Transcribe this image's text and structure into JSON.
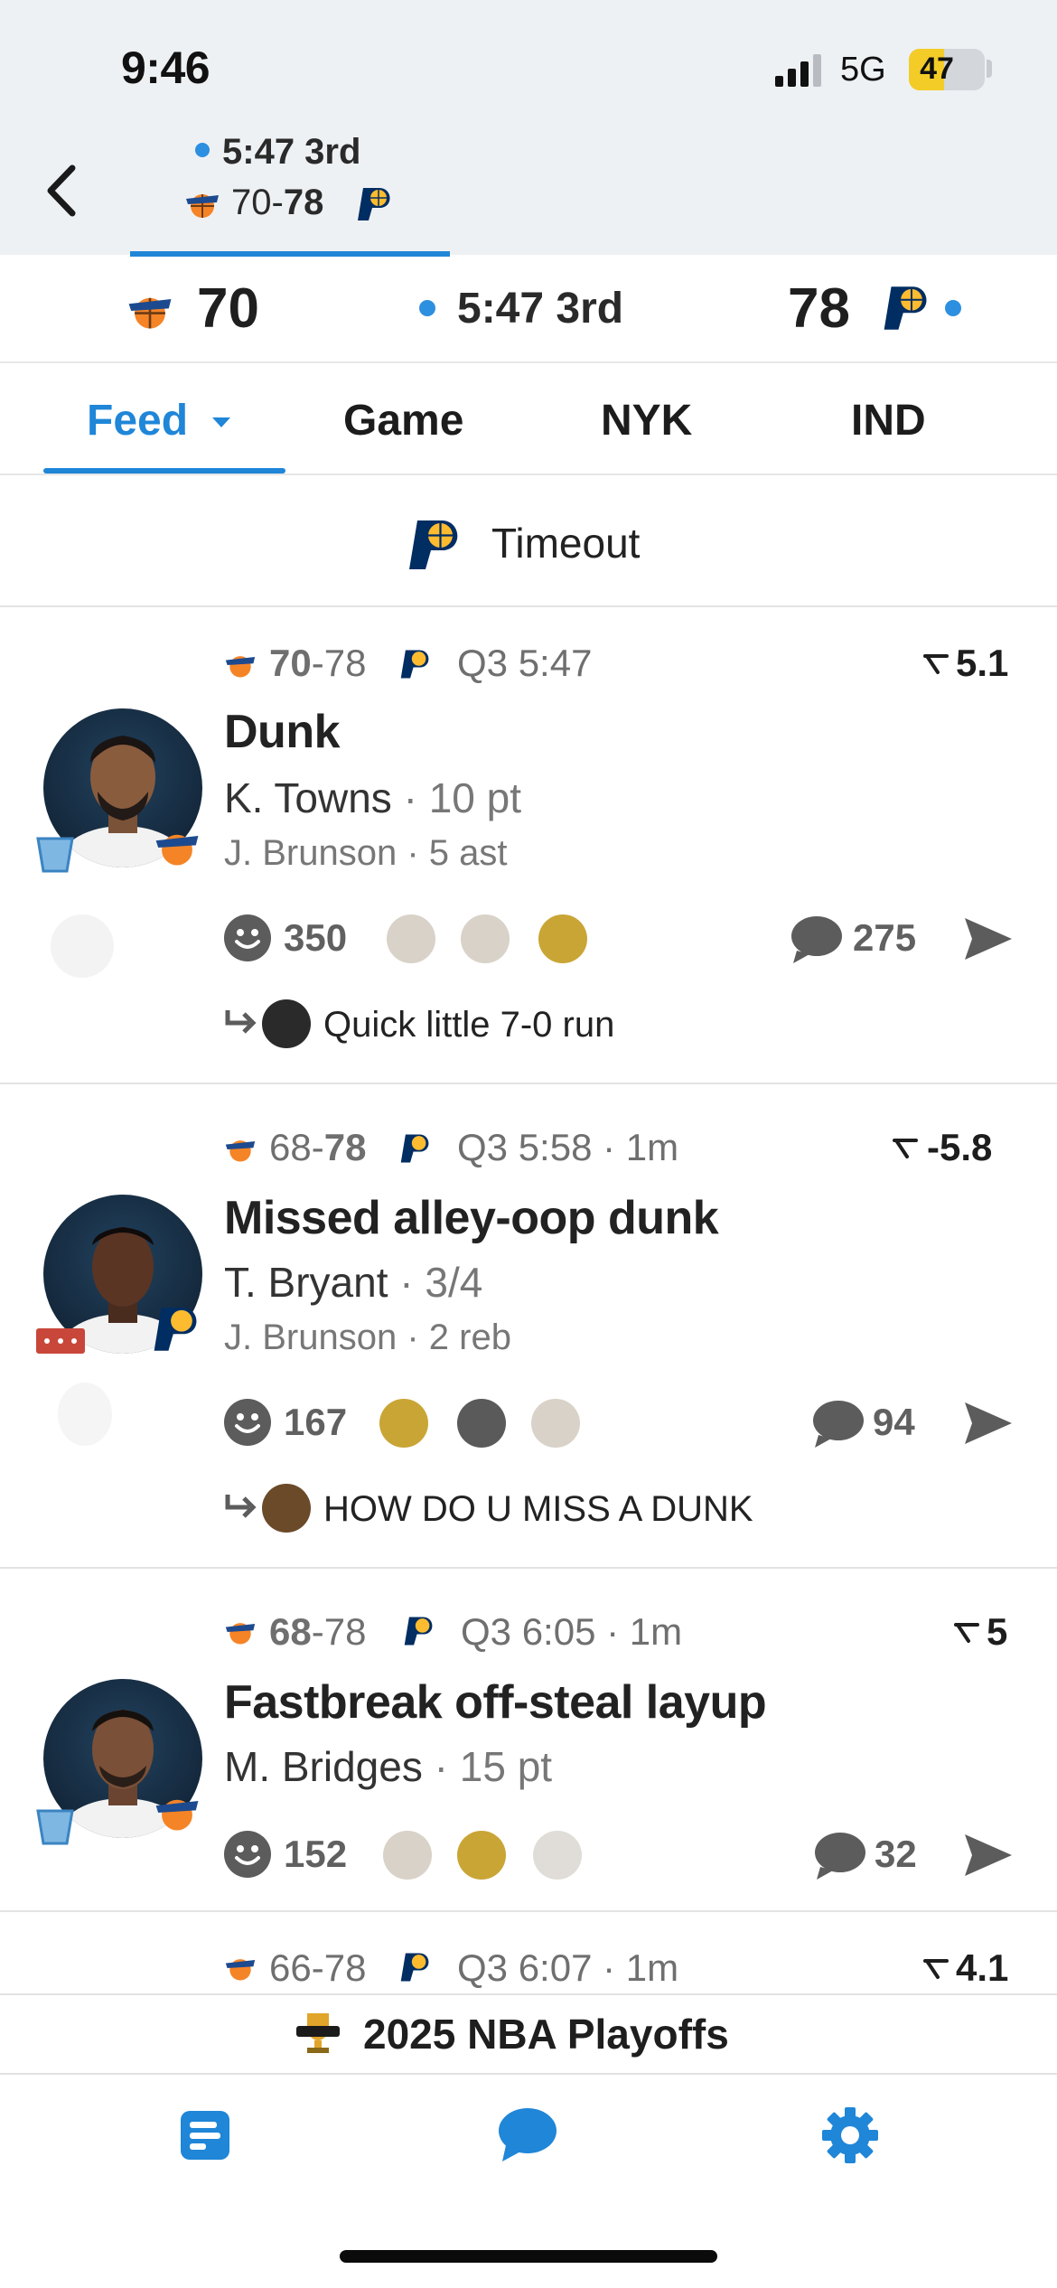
{
  "status_bar": {
    "time": "9:46",
    "network": "5G",
    "battery": "47",
    "battery_level": 0.47
  },
  "game_header": {
    "clock": "5:47 3rd",
    "away_score": "70",
    "score_sep": "-",
    "home_score": "78"
  },
  "scoreboard": {
    "away_score": "70",
    "clock": "5:47 3rd",
    "home_score": "78"
  },
  "tabs": [
    {
      "label": "Feed",
      "active": true
    },
    {
      "label": "Game",
      "active": false
    },
    {
      "label": "NYK",
      "active": false
    },
    {
      "label": "IND",
      "active": false
    }
  ],
  "timeout": {
    "label": "Timeout"
  },
  "plays": [
    {
      "away": "70",
      "sep": "-",
      "home": "78",
      "time": "Q3 5:47",
      "ago": "",
      "win_prob": "5.1",
      "title": "Dunk",
      "player": "K. Towns",
      "player_stat": "10 pt",
      "assist": "J. Brunson",
      "assist_stat": "5 ast",
      "reactions": "350",
      "comments": "275",
      "reply": "Quick little 7-0 run"
    },
    {
      "away": "68",
      "sep": "-",
      "home": "78",
      "time": "Q3 5:58",
      "ago": "1m",
      "win_prob": "-5.8",
      "title": "Missed alley-oop dunk",
      "player": "T. Bryant",
      "player_stat": "3/4",
      "assist": "J. Brunson",
      "assist_stat": "2 reb",
      "reactions": "167",
      "comments": "94",
      "reply": "HOW DO U MISS A DUNK"
    },
    {
      "away": "68",
      "sep": "-",
      "home": "78",
      "time": "Q3 6:05",
      "ago": "1m",
      "win_prob": "5",
      "title": "Fastbreak off-steal layup",
      "player": "M. Bridges",
      "player_stat": "15 pt",
      "reactions": "152",
      "comments": "32"
    },
    {
      "away": "66",
      "sep": "-",
      "home": "78",
      "time": "Q3 6:07",
      "ago": "1m",
      "win_prob": "4.1"
    }
  ],
  "banner": {
    "label": "2025 NBA Playoffs"
  },
  "icons": {
    "team_away": "knicks-logo",
    "team_home": "pacers-logo",
    "bottom_nav": [
      "feed-icon",
      "chat-icon",
      "settings-icon"
    ]
  },
  "colors": {
    "accent": "#1f86d8",
    "knicks_orange": "#f58426",
    "pacers_navy": "#002d62",
    "pacers_gold": "#fdbb30"
  }
}
